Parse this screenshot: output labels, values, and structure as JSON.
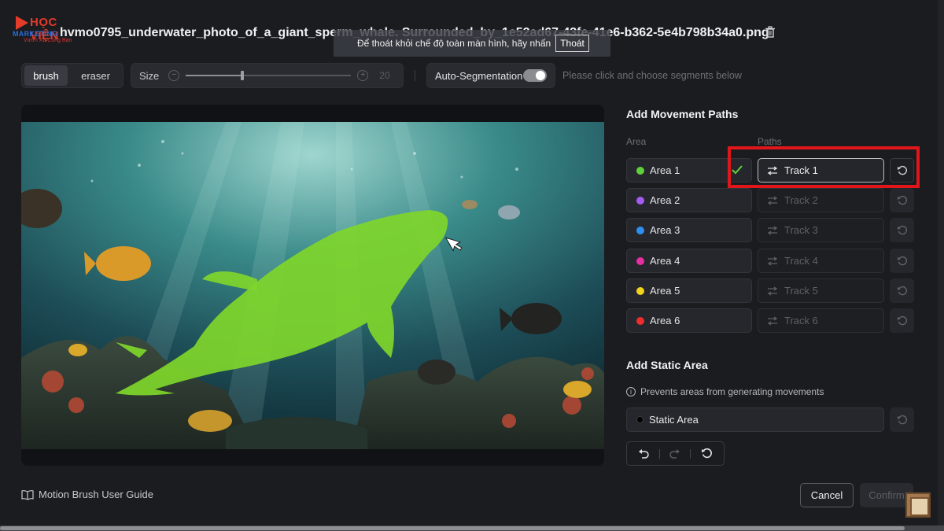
{
  "logo": {
    "line1": "HỌC VIỆN",
    "line2": "MARKETING",
    "line3": "Vươn Xa Cùng Bạn"
  },
  "header": {
    "filename": "hvmo0795_underwater_photo_of_a_giant_sperm_whale. Surrounded_by_1e52ad67-43fe-41e6-b362-5e4b798b34a0.png",
    "delete_icon": "trash-icon"
  },
  "fullscreen_banner": {
    "message": "Để thoát khỏi chế độ toàn màn hình, hãy nhấn",
    "exit_label": "Thoát"
  },
  "toolbar": {
    "brush_label": "brush",
    "eraser_label": "eraser",
    "active_mode": "brush",
    "size_label": "Size",
    "size_value": "20",
    "size_fraction": 0.34,
    "auto_seg_label": "Auto-Segmentation",
    "auto_seg_on": true,
    "hint": "Please click and choose segments below"
  },
  "panel": {
    "title": "Add Movement Paths",
    "area_header": "Area",
    "paths_header": "Paths",
    "rows": [
      {
        "area": "Area 1",
        "color": "#5fcf3a",
        "track": "Track 1",
        "done": true
      },
      {
        "area": "Area 2",
        "color": "#a45cf0",
        "track": "Track 2",
        "done": false
      },
      {
        "area": "Area 3",
        "color": "#2e8ff0",
        "track": "Track 3",
        "done": false
      },
      {
        "area": "Area 4",
        "color": "#e62fa0",
        "track": "Track 4",
        "done": false
      },
      {
        "area": "Area 5",
        "color": "#f1d31c",
        "track": "Track 5",
        "done": false
      },
      {
        "area": "Area 6",
        "color": "#ee2e2e",
        "track": "Track 6",
        "done": false
      }
    ],
    "static_title": "Add Static Area",
    "static_info": "Prevents areas from generating movements",
    "static_label": "Static Area"
  },
  "footer": {
    "guide_label": "Motion Brush User Guide",
    "cancel_label": "Cancel",
    "confirm_label": "Confirm"
  },
  "colors": {
    "highlight": "#e0161b",
    "mask": "#7fd62a"
  }
}
